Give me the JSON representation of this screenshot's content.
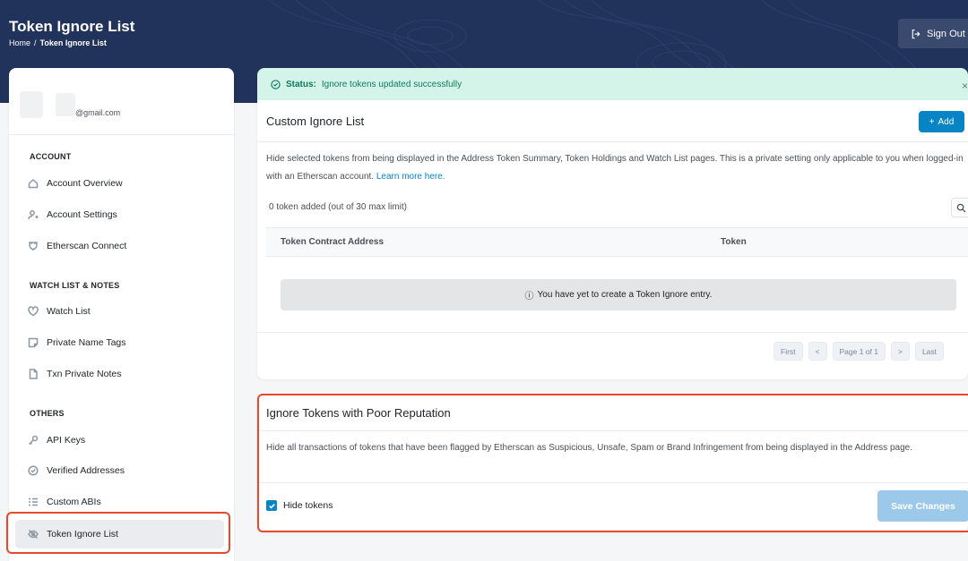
{
  "header": {
    "title": "Token Ignore List",
    "breadcrumb": {
      "home": "Home",
      "separator": "/",
      "current": "Token Ignore List"
    },
    "signout_label": "Sign Out"
  },
  "sidebar": {
    "email": "@gmail.com",
    "sections": {
      "account": "ACCOUNT",
      "watchlist": "WATCH LIST & NOTES",
      "others": "OTHERS"
    },
    "items": [
      {
        "label": "Account Overview",
        "icon": "home-icon"
      },
      {
        "label": "Account Settings",
        "icon": "user-settings-icon"
      },
      {
        "label": "Etherscan Connect",
        "icon": "connect-icon"
      },
      {
        "label": "Watch List",
        "icon": "heart-icon"
      },
      {
        "label": "Private Name Tags",
        "icon": "tag-note-icon"
      },
      {
        "label": "Txn Private Notes",
        "icon": "file-icon"
      },
      {
        "label": "API Keys",
        "icon": "key-icon"
      },
      {
        "label": "Verified Addresses",
        "icon": "check-circle-icon"
      },
      {
        "label": "Custom ABIs",
        "icon": "list-icon"
      },
      {
        "label": "Token Ignore List",
        "icon": "eye-slash-icon"
      }
    ]
  },
  "status": {
    "label": "Status:",
    "message": "Ignore tokens updated successfully",
    "close": "×"
  },
  "custom_list": {
    "title": "Custom Ignore List",
    "add_label": "Add",
    "description": "Hide selected tokens from being displayed in the Address Token Summary, Token Holdings and Watch List pages. This is a private setting only applicable to you when logged-in with an Etherscan account.",
    "learn_more": "Learn more here.",
    "count_text": "0 token added (out of 30 max limit)",
    "columns": [
      "Token Contract Address",
      "Token"
    ],
    "empty_message": "You have yet to create a Token Ignore entry.",
    "pagination": {
      "first": "First",
      "prev": "<",
      "page": "Page 1 of 1",
      "next": ">",
      "last": "Last"
    }
  },
  "poor_reputation": {
    "title": "Ignore Tokens with Poor Reputation",
    "description": "Hide all transactions of tokens that have been flagged by Etherscan as Suspicious, Unsafe, Spam or Brand Infringement from being displayed in the Address page.",
    "checkbox_label": "Hide tokens",
    "checkbox_checked": true,
    "save_label": "Save Changes"
  },
  "colors": {
    "header_bg": "#21325b",
    "accent": "#0784c3",
    "status_bg": "#d4f4ea",
    "highlight": "#e6492d"
  }
}
